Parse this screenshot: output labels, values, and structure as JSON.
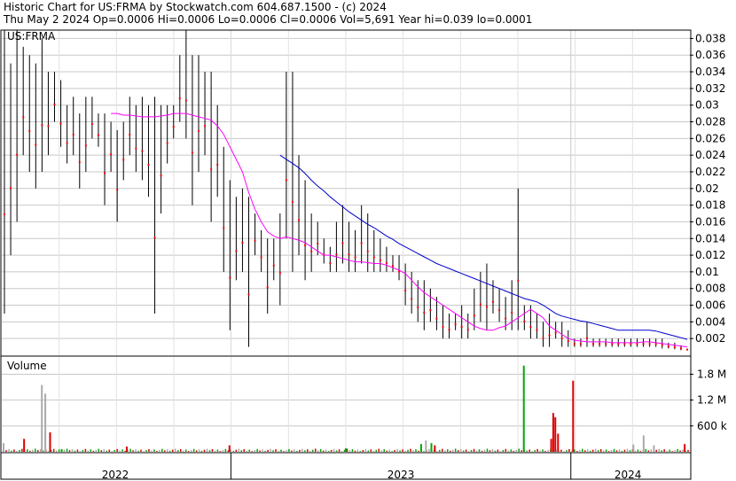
{
  "header": {
    "line1": "Historic Chart for US:FRMA by Stockwatch.com 604.687.1500 - (c) 2024",
    "line2": "Thu May  2 2024  Op=0.0006  Hi=0.0006  Lo=0.0006  Cl=0.0006  Vol=5,691  Year hi=0.039  lo=0.0001"
  },
  "colors": {
    "price_bar": "#000000",
    "close_dot": "#ff0000",
    "ma_short": "#ff00ff",
    "ma_long": "#0000cc",
    "vol_up": "#00aa00",
    "vol_down": "#dd0000",
    "vol_flat": "#aaaaaa",
    "grid": "#c8c8c8"
  },
  "chart_data": [
    {
      "type": "line",
      "symbol": "US:FRMA",
      "x_axis_labels": [
        "2022",
        "2023",
        "2024"
      ],
      "y_tick_labels": [
        "0.038",
        "0.036",
        "0.034",
        "0.032",
        "0.03",
        "0.028",
        "0.026",
        "0.024",
        "0.022",
        "0.02",
        "0.018",
        "0.016",
        "0.014",
        "0.012",
        "0.01",
        "0.008",
        "0.006",
        "0.004",
        "0.002"
      ],
      "ylim": [
        0,
        0.039
      ],
      "grid": true,
      "series": [
        {
          "name": "",
          "style": "hi-lo bars",
          "values": [
            [
              0.005,
              0.039
            ],
            [
              0.012,
              0.035
            ],
            [
              0.016,
              0.039
            ],
            [
              0.024,
              0.037
            ],
            [
              0.022,
              0.036
            ],
            [
              0.02,
              0.035
            ],
            [
              0.022,
              0.038
            ],
            [
              0.024,
              0.034
            ],
            [
              0.028,
              0.034
            ],
            [
              0.025,
              0.033
            ],
            [
              0.023,
              0.03
            ],
            [
              0.024,
              0.031
            ],
            [
              0.02,
              0.029
            ],
            [
              0.022,
              0.031
            ],
            [
              0.026,
              0.031
            ],
            [
              0.025,
              0.029
            ],
            [
              0.018,
              0.029
            ],
            [
              0.022,
              0.028
            ],
            [
              0.016,
              0.027
            ],
            [
              0.021,
              0.028
            ],
            [
              0.024,
              0.031
            ],
            [
              0.022,
              0.03
            ],
            [
              0.021,
              0.031
            ],
            [
              0.019,
              0.03
            ],
            [
              0.005,
              0.031
            ],
            [
              0.017,
              0.03
            ],
            [
              0.023,
              0.03
            ],
            [
              0.026,
              0.03
            ],
            [
              0.028,
              0.036
            ],
            [
              0.026,
              0.039
            ],
            [
              0.018,
              0.036
            ],
            [
              0.022,
              0.036
            ],
            [
              0.024,
              0.034
            ],
            [
              0.016,
              0.034
            ],
            [
              0.019,
              0.03
            ],
            [
              0.01,
              0.025
            ],
            [
              0.003,
              0.021
            ],
            [
              0.009,
              0.019
            ],
            [
              0.01,
              0.02
            ],
            [
              0.001,
              0.019
            ],
            [
              0.012,
              0.017
            ],
            [
              0.01,
              0.015
            ],
            [
              0.005,
              0.014
            ],
            [
              0.009,
              0.014
            ],
            [
              0.006,
              0.017
            ],
            [
              0.014,
              0.034
            ],
            [
              0.01,
              0.034
            ],
            [
              0.012,
              0.024
            ],
            [
              0.009,
              0.021
            ],
            [
              0.01,
              0.017
            ],
            [
              0.012,
              0.016
            ],
            [
              0.011,
              0.014
            ],
            [
              0.01,
              0.013
            ],
            [
              0.01,
              0.016
            ],
            [
              0.011,
              0.018
            ],
            [
              0.01,
              0.016
            ],
            [
              0.01,
              0.015
            ],
            [
              0.011,
              0.018
            ],
            [
              0.01,
              0.017
            ],
            [
              0.01,
              0.015
            ],
            [
              0.01,
              0.014
            ],
            [
              0.01,
              0.013
            ],
            [
              0.01,
              0.012
            ],
            [
              0.009,
              0.012
            ],
            [
              0.006,
              0.011
            ],
            [
              0.005,
              0.01
            ],
            [
              0.004,
              0.009
            ],
            [
              0.003,
              0.009
            ],
            [
              0.004,
              0.008
            ],
            [
              0.003,
              0.007
            ],
            [
              0.002,
              0.006
            ],
            [
              0.002,
              0.005
            ],
            [
              0.003,
              0.005
            ],
            [
              0.002,
              0.006
            ],
            [
              0.002,
              0.005
            ],
            [
              0.003,
              0.008
            ],
            [
              0.004,
              0.01
            ],
            [
              0.003,
              0.011
            ],
            [
              0.005,
              0.009
            ],
            [
              0.004,
              0.008
            ],
            [
              0.003,
              0.007
            ],
            [
              0.003,
              0.009
            ],
            [
              0.003,
              0.02
            ],
            [
              0.003,
              0.006
            ],
            [
              0.002,
              0.006
            ],
            [
              0.002,
              0.005
            ],
            [
              0.001,
              0.004
            ],
            [
              0.001,
              0.005
            ],
            [
              0.002,
              0.004
            ],
            [
              0.001,
              0.004
            ],
            [
              0.001,
              0.003
            ],
            [
              0.001,
              0.002
            ],
            [
              0.001,
              0.002
            ],
            [
              0.001,
              0.004
            ],
            [
              0.001,
              0.002
            ],
            [
              0.001,
              0.002
            ],
            [
              0.001,
              0.002
            ],
            [
              0.001,
              0.002
            ],
            [
              0.001,
              0.002
            ],
            [
              0.001,
              0.002
            ],
            [
              0.001,
              0.002
            ],
            [
              0.001,
              0.002
            ],
            [
              0.001,
              0.002
            ],
            [
              0.001,
              0.002
            ],
            [
              0.001,
              0.002
            ],
            [
              0.0008,
              0.002
            ],
            [
              0.0008,
              0.0015
            ],
            [
              0.0007,
              0.0015
            ],
            [
              0.0006,
              0.0012
            ],
            [
              0.0006,
              0.0008
            ]
          ]
        },
        {
          "name": "",
          "style": "moving average",
          "values": [
            null,
            null,
            null,
            null,
            null,
            null,
            null,
            null,
            null,
            null,
            null,
            null,
            null,
            null,
            null,
            null,
            null,
            0.029,
            0.029,
            0.0288,
            0.0288,
            0.0287,
            0.0286,
            0.0286,
            0.0286,
            0.0287,
            0.0288,
            0.029,
            0.029,
            0.029,
            0.0288,
            0.0286,
            0.0284,
            0.0282,
            0.0275,
            0.0265,
            0.025,
            0.0235,
            0.022,
            0.0195,
            0.0175,
            0.016,
            0.0148,
            0.0143,
            0.014,
            0.0142,
            0.014,
            0.0138,
            0.0135,
            0.013,
            0.0125,
            0.012,
            0.012,
            0.0118,
            0.0116,
            0.0114,
            0.0112,
            0.0112,
            0.0111,
            0.011,
            0.011,
            0.0108,
            0.0105,
            0.0102,
            0.0098,
            0.009,
            0.0082,
            0.0075,
            0.007,
            0.0065,
            0.006,
            0.0055,
            0.005,
            0.0045,
            0.004,
            0.0035,
            0.0032,
            0.003,
            0.003,
            0.0033,
            0.0035,
            0.004,
            0.0045,
            0.005,
            0.0055,
            0.005,
            0.0045,
            0.0035,
            0.003,
            0.0025,
            0.002,
            0.0018,
            0.0017,
            0.0016,
            0.0016,
            0.0016,
            0.0016,
            0.0015,
            0.0015,
            0.0015,
            0.0015,
            0.0015,
            0.0016,
            0.0016,
            0.0015,
            0.0014,
            0.0013,
            0.0012,
            0.0011,
            0.001
          ]
        },
        {
          "name": "",
          "style": "moving average",
          "values": [
            null,
            null,
            null,
            null,
            null,
            null,
            null,
            null,
            null,
            null,
            null,
            null,
            null,
            null,
            null,
            null,
            null,
            null,
            null,
            null,
            null,
            null,
            null,
            null,
            null,
            null,
            null,
            null,
            null,
            null,
            null,
            null,
            null,
            null,
            null,
            null,
            null,
            null,
            null,
            null,
            null,
            null,
            null,
            null,
            0.024,
            0.0235,
            0.023,
            0.0225,
            0.0218,
            0.021,
            0.0203,
            0.0197,
            0.019,
            0.0184,
            0.0178,
            0.0172,
            0.0167,
            0.0162,
            0.0157,
            0.0153,
            0.0148,
            0.0143,
            0.0139,
            0.0134,
            0.013,
            0.0126,
            0.0122,
            0.0118,
            0.0114,
            0.011,
            0.0107,
            0.0104,
            0.0101,
            0.0098,
            0.0095,
            0.0092,
            0.0089,
            0.0086,
            0.0083,
            0.008,
            0.0077,
            0.0074,
            0.0071,
            0.0068,
            0.0066,
            0.0064,
            0.006,
            0.0055,
            0.005,
            0.0047,
            0.0045,
            0.0043,
            0.0041,
            0.004,
            0.0038,
            0.0036,
            0.0034,
            0.0032,
            0.003,
            0.003,
            0.003,
            0.003,
            0.003,
            0.003,
            0.0029,
            0.0027,
            0.0025,
            0.0023,
            0.0021,
            0.0019
          ]
        }
      ]
    },
    {
      "type": "bar",
      "title": "Volume",
      "y_tick_labels": [
        "1.8 M",
        "1.2 M",
        "600 k"
      ],
      "ylim": [
        0,
        2200000
      ],
      "tall_bars": [
        {
          "pos": 0.0,
          "value": 200000,
          "dir": "flat"
        },
        {
          "pos": 0.03,
          "value": 300000,
          "dir": "down"
        },
        {
          "pos": 0.068,
          "value": 450000,
          "dir": "down"
        },
        {
          "pos": 0.056,
          "value": 1550000,
          "dir": "flat"
        },
        {
          "pos": 0.061,
          "value": 1350000,
          "dir": "flat"
        },
        {
          "pos": 0.085,
          "value": 60000,
          "dir": "up"
        },
        {
          "pos": 0.18,
          "value": 120000,
          "dir": "down"
        },
        {
          "pos": 0.33,
          "value": 150000,
          "dir": "down"
        },
        {
          "pos": 0.5,
          "value": 80000,
          "dir": "up"
        },
        {
          "pos": 0.61,
          "value": 180000,
          "dir": "up"
        },
        {
          "pos": 0.617,
          "value": 260000,
          "dir": "flat"
        },
        {
          "pos": 0.625,
          "value": 200000,
          "dir": "up"
        },
        {
          "pos": 0.63,
          "value": 150000,
          "dir": "down"
        },
        {
          "pos": 0.76,
          "value": 2000000,
          "dir": "up"
        },
        {
          "pos": 0.8,
          "value": 300000,
          "dir": "down"
        },
        {
          "pos": 0.803,
          "value": 900000,
          "dir": "down"
        },
        {
          "pos": 0.806,
          "value": 800000,
          "dir": "down"
        },
        {
          "pos": 0.81,
          "value": 420000,
          "dir": "down"
        },
        {
          "pos": 0.832,
          "value": 1650000,
          "dir": "down"
        },
        {
          "pos": 0.935,
          "value": 380000,
          "dir": "flat"
        },
        {
          "pos": 0.92,
          "value": 170000,
          "dir": "flat"
        },
        {
          "pos": 0.95,
          "value": 150000,
          "dir": "flat"
        },
        {
          "pos": 0.995,
          "value": 180000,
          "dir": "down"
        }
      ]
    }
  ]
}
